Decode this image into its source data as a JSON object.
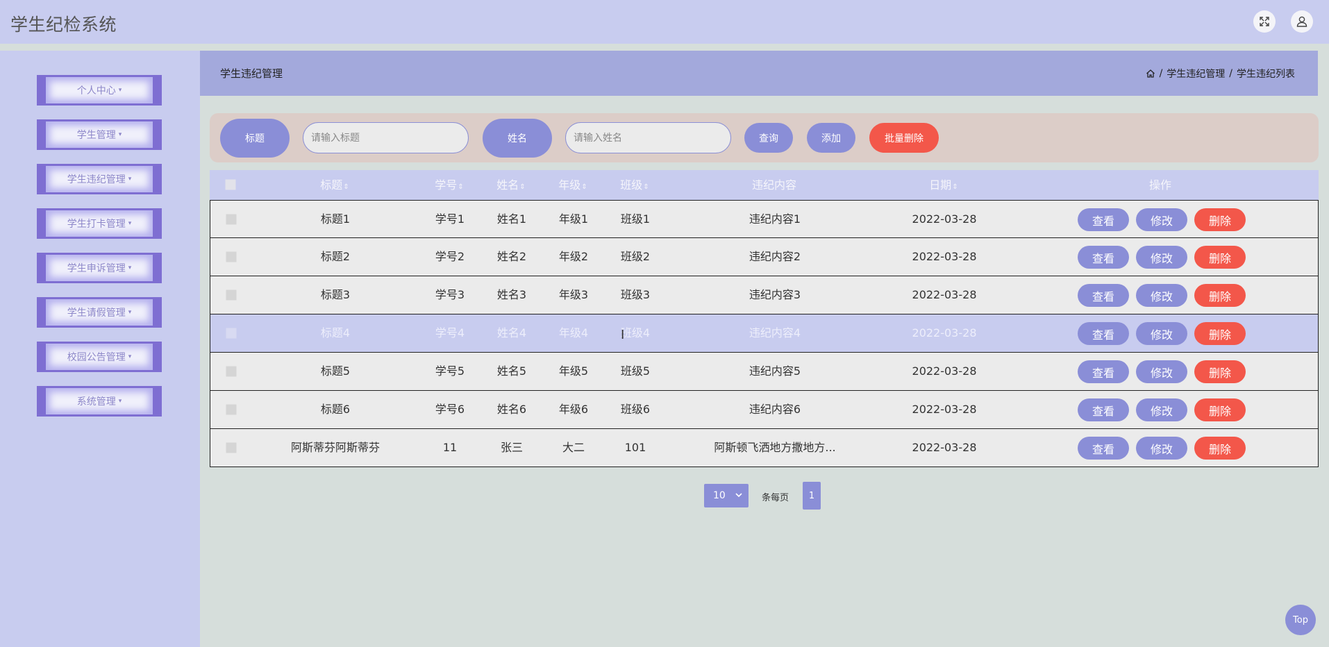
{
  "header": {
    "app_title": "学生纪检系统",
    "fullscreen_icon": "fullscreen-icon",
    "user_icon": "user-icon"
  },
  "sidebar": {
    "items": [
      {
        "label": "个人中心"
      },
      {
        "label": "学生管理"
      },
      {
        "label": "学生违纪管理"
      },
      {
        "label": "学生打卡管理"
      },
      {
        "label": "学生申诉管理"
      },
      {
        "label": "学生请假管理"
      },
      {
        "label": "校园公告管理"
      },
      {
        "label": "系统管理"
      }
    ],
    "caret": "▾"
  },
  "page": {
    "title": "学生违纪管理",
    "breadcrumb": {
      "home_icon": "home-icon",
      "sep": "/",
      "level1": "学生违纪管理",
      "level2": "学生违纪列表"
    }
  },
  "search": {
    "title_label": "标题",
    "title_placeholder": "请输入标题",
    "name_label": "姓名",
    "name_placeholder": "请输入姓名",
    "query_btn": "查询",
    "add_btn": "添加",
    "batch_delete_btn": "批量删除"
  },
  "table": {
    "columns": {
      "title": "标题",
      "student_no": "学号",
      "name": "姓名",
      "grade": "年级",
      "class": "班级",
      "content": "违纪内容",
      "date": "日期",
      "action": "操作"
    },
    "sort_glyph": "⇕",
    "rows": [
      {
        "title": "标题1",
        "student_no": "学号1",
        "name": "姓名1",
        "grade": "年级1",
        "class": "班级1",
        "content": "违纪内容1",
        "date": "2022-03-28"
      },
      {
        "title": "标题2",
        "student_no": "学号2",
        "name": "姓名2",
        "grade": "年级2",
        "class": "班级2",
        "content": "违纪内容2",
        "date": "2022-03-28"
      },
      {
        "title": "标题3",
        "student_no": "学号3",
        "name": "姓名3",
        "grade": "年级3",
        "class": "班级3",
        "content": "违纪内容3",
        "date": "2022-03-28"
      },
      {
        "title": "标题4",
        "student_no": "学号4",
        "name": "姓名4",
        "grade": "年级4",
        "class": "班级4",
        "content": "违纪内容4",
        "date": "2022-03-28"
      },
      {
        "title": "标题5",
        "student_no": "学号5",
        "name": "姓名5",
        "grade": "年级5",
        "class": "班级5",
        "content": "违纪内容5",
        "date": "2022-03-28"
      },
      {
        "title": "标题6",
        "student_no": "学号6",
        "name": "姓名6",
        "grade": "年级6",
        "class": "班级6",
        "content": "违纪内容6",
        "date": "2022-03-28"
      },
      {
        "title": "阿斯蒂芬阿斯蒂芬",
        "student_no": "11",
        "name": "张三",
        "grade": "大二",
        "class": "101",
        "content": "阿斯顿飞洒地方撒地方...",
        "date": "2022-03-28"
      }
    ],
    "actions": {
      "view": "查看",
      "edit": "修改",
      "delete": "删除"
    }
  },
  "pagination": {
    "page_size": "10",
    "per_page_label": "条每页",
    "current_page": "1"
  },
  "back_to_top": "Top",
  "colors": {
    "accent": "#8a8ed7",
    "danger": "#f3574a",
    "header_bg": "#c8ccef",
    "content_bg": "#d6dedb"
  }
}
